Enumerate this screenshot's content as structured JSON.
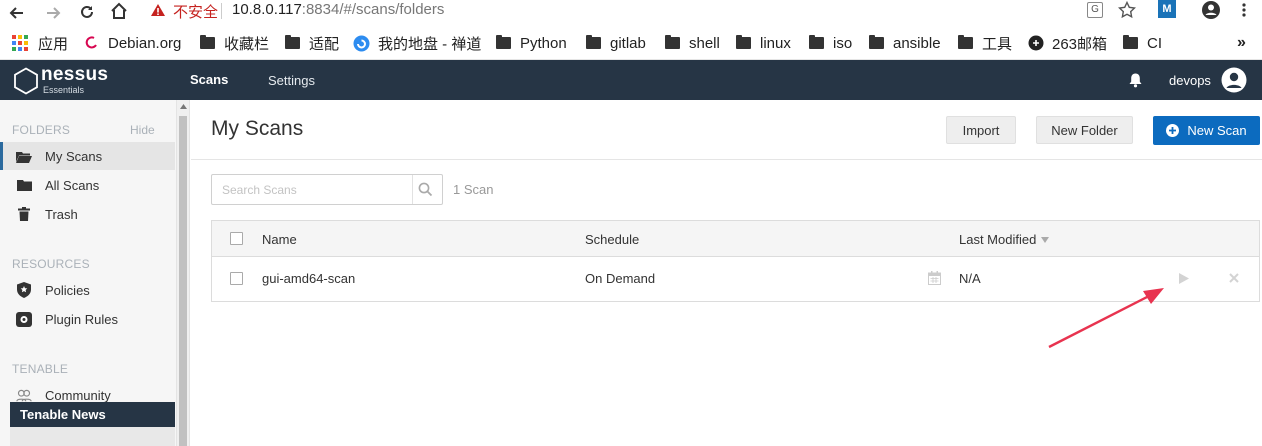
{
  "browser": {
    "security_warning": "不安全",
    "url_host": "10.8.0.117",
    "url_rest": ":8834/#/scans/folders",
    "bookmarks": [
      {
        "label": "应用",
        "icon": "apps-grid-icon"
      },
      {
        "label": "Debian.org",
        "icon": "debian-icon"
      },
      {
        "label": "收藏栏",
        "icon": "folder-icon"
      },
      {
        "label": "适配",
        "icon": "folder-icon"
      },
      {
        "label": "我的地盘 - 禅道",
        "icon": "zentao-icon"
      },
      {
        "label": "Python",
        "icon": "folder-icon"
      },
      {
        "label": "gitlab",
        "icon": "folder-icon"
      },
      {
        "label": "shell",
        "icon": "folder-icon"
      },
      {
        "label": "linux",
        "icon": "folder-icon"
      },
      {
        "label": "iso",
        "icon": "folder-icon"
      },
      {
        "label": "ansible",
        "icon": "folder-icon"
      },
      {
        "label": "工具",
        "icon": "folder-icon"
      },
      {
        "label": "263邮箱",
        "icon": "mail263-icon"
      },
      {
        "label": "CI",
        "icon": "folder-icon"
      }
    ],
    "more": "»"
  },
  "app": {
    "logo_name": "nessus",
    "logo_sub": "Essentials",
    "nav": {
      "scans": "Scans",
      "settings": "Settings"
    },
    "user": "devops"
  },
  "sidebar": {
    "folders_heading": "FOLDERS",
    "hide_label": "Hide",
    "folders": [
      {
        "label": "My Scans",
        "icon": "folder-open-icon",
        "active": true
      },
      {
        "label": "All Scans",
        "icon": "folder-icon",
        "active": false
      },
      {
        "label": "Trash",
        "icon": "trash-icon",
        "active": false
      }
    ],
    "resources_heading": "RESOURCES",
    "resources": [
      {
        "label": "Policies",
        "icon": "shield-star-icon"
      },
      {
        "label": "Plugin Rules",
        "icon": "plugin-icon"
      }
    ],
    "tenable_heading": "TENABLE",
    "tenable": [
      {
        "label": "Community",
        "icon": "community-icon"
      }
    ],
    "news_label": "Tenable News"
  },
  "main": {
    "title": "My Scans",
    "buttons": {
      "import": "Import",
      "new_folder": "New Folder",
      "new_scan": "New Scan"
    },
    "search_placeholder": "Search Scans",
    "scan_count": "1 Scan",
    "columns": {
      "name": "Name",
      "schedule": "Schedule",
      "last_modified": "Last Modified"
    },
    "rows": [
      {
        "name": "gui-amd64-scan",
        "schedule": "On Demand",
        "last_modified": "N/A"
      }
    ]
  },
  "colors": {
    "nav_bg": "#263545",
    "accent_blue": "#0c6bbf",
    "annotation_arrow": "#e8334f"
  }
}
